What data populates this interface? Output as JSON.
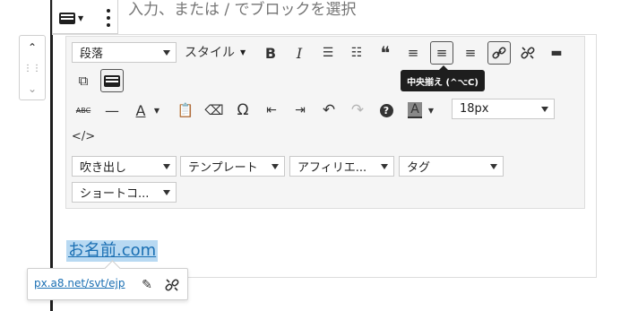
{
  "placeholder": "入力、または / でブロックを選択",
  "toolbar": {
    "format_select": "段落",
    "style_select": "スタイル",
    "font_size": "18px",
    "tooltip": "中央揃え (^⌥C)",
    "row4": {
      "balloon": "吹き出し",
      "template": "テンプレート",
      "affiliate": "アフィリエ...",
      "tag": "タグ"
    },
    "row5": {
      "shortcode": "ショートコ..."
    },
    "labels": {
      "bold": "B",
      "italic": "I",
      "quote": "❝",
      "strike": "ABC",
      "omega": "Ω",
      "textcolor": "A",
      "help": "?",
      "code": "</>"
    }
  },
  "link": {
    "text": "お名前.com",
    "url": "px.a8.net/svt/ejp"
  }
}
